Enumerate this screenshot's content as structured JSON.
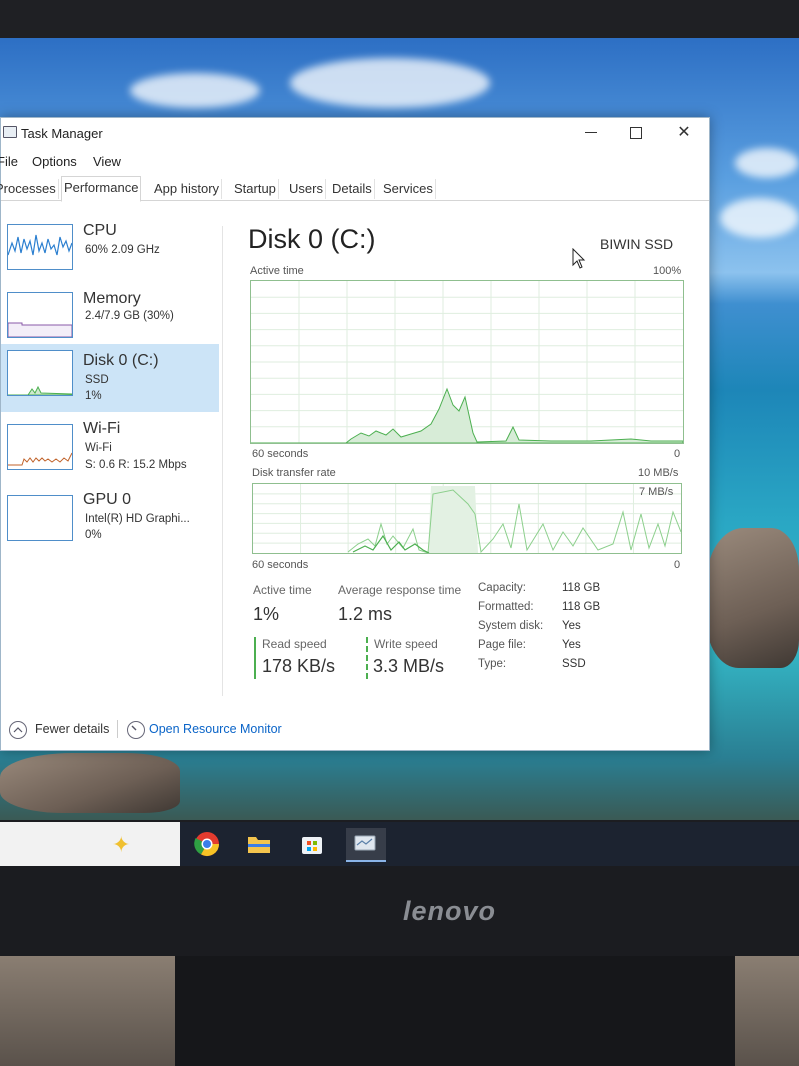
{
  "window": {
    "title": "Task Manager"
  },
  "menu": [
    "File",
    "Options",
    "View"
  ],
  "tabs": [
    "Processes",
    "Performance",
    "App history",
    "Startup",
    "Users",
    "Details",
    "Services"
  ],
  "sidebar": {
    "items": [
      {
        "name": "CPU",
        "line1": "60%  2.09 GHz",
        "line2": ""
      },
      {
        "name": "Memory",
        "line1": "2.4/7.9 GB (30%)",
        "line2": ""
      },
      {
        "name": "Disk 0 (C:)",
        "line1": "SSD",
        "line2": "1%"
      },
      {
        "name": "Wi-Fi",
        "line1": "Wi-Fi",
        "line2": "S: 0.6  R: 15.2 Mbps"
      },
      {
        "name": "GPU 0",
        "line1": "Intel(R) HD Graphi...",
        "line2": "0%"
      }
    ]
  },
  "disk": {
    "title": "Disk 0 (C:)",
    "model": "BIWIN SSD",
    "active_time_graph": {
      "label": "Active time",
      "max": "100%",
      "x_left": "60 seconds",
      "x_right": "0"
    },
    "transfer_graph": {
      "label": "Disk transfer rate",
      "max": "10 MB/s",
      "ref": "7 MB/s",
      "x_left": "60 seconds",
      "x_right": "0"
    },
    "stats": {
      "active_time_label": "Active time",
      "active_time_value": "1%",
      "avg_response_label": "Average response time",
      "avg_response_value": "1.2 ms",
      "read_label": "Read speed",
      "read_value": "178 KB/s",
      "write_label": "Write speed",
      "write_value": "3.3 MB/s"
    },
    "properties": [
      {
        "key": "Capacity:",
        "value": "118 GB"
      },
      {
        "key": "Formatted:",
        "value": "118 GB"
      },
      {
        "key": "System disk:",
        "value": "Yes"
      },
      {
        "key": "Page file:",
        "value": "Yes"
      },
      {
        "key": "Type:",
        "value": "SSD"
      }
    ]
  },
  "footer": {
    "fewer_details": "Fewer details",
    "resource_monitor": "Open Resource Monitor"
  },
  "brand": "lenovo",
  "colors": {
    "accent": "#0a64c8",
    "disk_graph": "#4caf50",
    "selection": "#cce4f7"
  }
}
